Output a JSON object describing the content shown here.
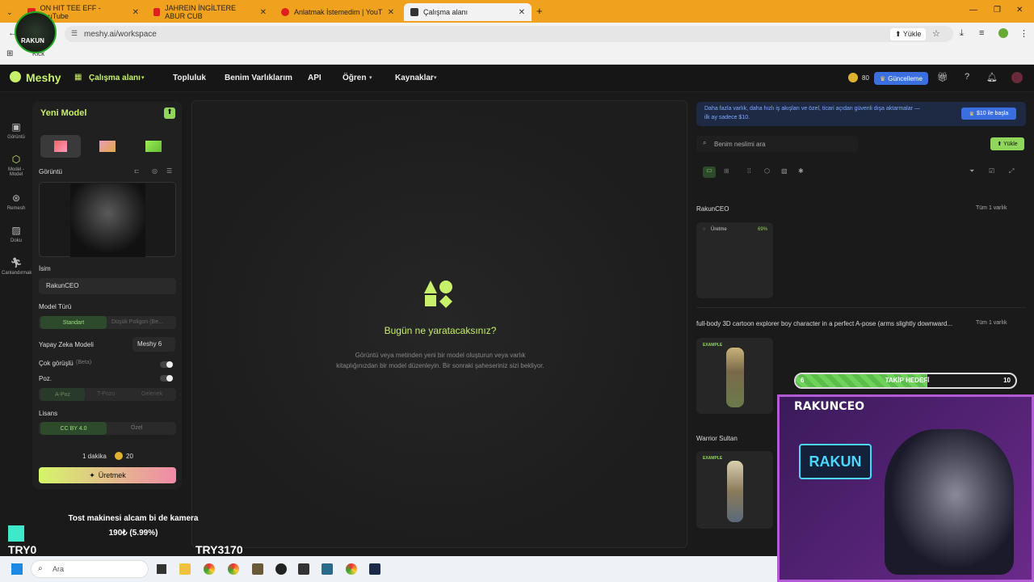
{
  "browser": {
    "tabs": [
      {
        "title": "ON HIT TEE EFF - YouTube"
      },
      {
        "title": "JAHREIN İNGİLTERE ABUR CUB"
      },
      {
        "title": "Anlatmak İstemedim | YouT"
      },
      {
        "title": "Çalışma alanı"
      }
    ],
    "url": "meshy.ai/workspace",
    "upload_btn": "Yükle",
    "bookmark": "Kick"
  },
  "header": {
    "logo": "Meshy",
    "nav": [
      "Çalışma alanı",
      "Topluluk",
      "Benim Varlıklarım",
      "API",
      "Öğren",
      "Kaynaklar"
    ],
    "credits": "80",
    "upgrade": "Güncelleme"
  },
  "sidebar": {
    "items": [
      "Görüntü",
      "Model - Model",
      "Remesh",
      "Doku",
      "Canlandırmak"
    ]
  },
  "left_panel": {
    "title": "Yeni Model",
    "image_label": "Görüntü",
    "name_label": "İsim",
    "name_value": "RakunCEO",
    "model_type_label": "Model Türü",
    "model_type_opts": [
      "Standart",
      "Düşük Poligon (Be..."
    ],
    "ai_model_label": "Yapay Zeka Modeli",
    "ai_model_value": "Meshy 6",
    "multi_view_label": "Çok görüşlü",
    "multi_view_beta": "(Beta)",
    "pose_label": "Poz.",
    "pose_opts": [
      "A-Poz",
      "T-Pozu",
      "Gelenek"
    ],
    "license_label": "Lisans",
    "license_opts": [
      "CC BY 4.0",
      "Özel"
    ],
    "time": "1 dakika",
    "cost": "20",
    "generate": "Üretmek"
  },
  "center": {
    "heading": "Bugün ne yaratacaksınız?",
    "line1": "Görüntü veya metinden yeni bir model oluşturun veya varlık",
    "line2": "kitaplığınızdan bir model düzenleyin. Bir sonraki şaheseriniz sizi bekliyor."
  },
  "right": {
    "promo_line1": "Daha fazla varlık, daha hızlı iş akışları ve özel, ticari açıdan güvenli dışa aktarmalar —",
    "promo_line2": "ilk ay sadece $10.",
    "promo_btn": "$10 ile başla",
    "search_placeholder": "Benim neslimi ara",
    "upload": "Yükle",
    "group1_title": "RakunCEO",
    "group1_link": "Tüm 1 varlık",
    "gen_status": "Üretme",
    "gen_percent": "69%",
    "group2_title": "full-body 3D cartoon explorer boy character in a perfect A-pose (arms slightly downward...",
    "group2_link": "Tüm 1 varlık",
    "example": "EXAMPLE",
    "group3_title": "Warrior Sultan"
  },
  "overlay": {
    "goal_left": "6",
    "goal_label": "TAKİP HEDEFİ",
    "goal_right": "10",
    "goal_progress": 0.6,
    "streamer": "RAKUNCEO",
    "sign": "RAKUN",
    "donation_text": "Tost makinesi alcam bi de kamera",
    "donation_amount": "190₺ (5.99%)",
    "try_left": "TRY0",
    "try_right": "TRY3170"
  },
  "taskbar": {
    "search": "Ara"
  },
  "colors": {
    "accent_green": "#c8f06a",
    "brand_blue": "#3b6fe0",
    "chrome_orange": "#f0a11d"
  }
}
